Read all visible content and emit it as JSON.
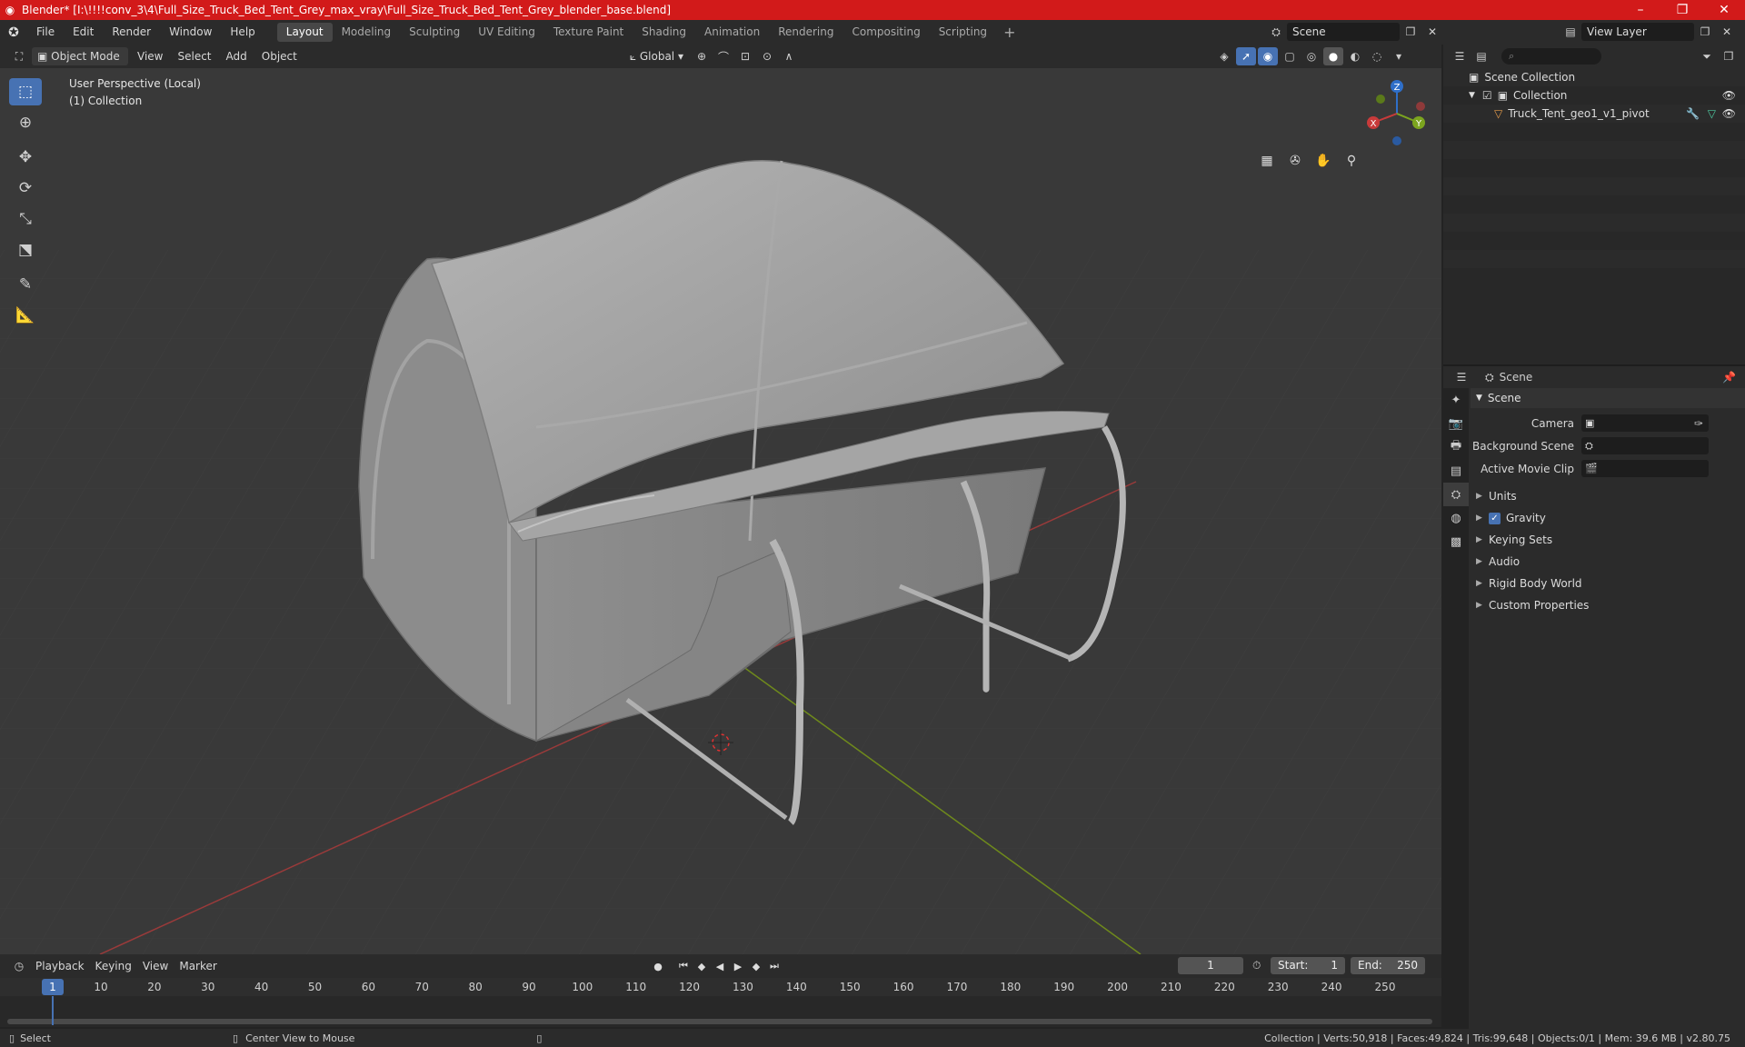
{
  "window": {
    "title": "Blender* [I:\\!!!!conv_3\\4\\Full_Size_Truck_Bed_Tent_Grey_max_vray\\Full_Size_Truck_Bed_Tent_Grey_blender_base.blend]",
    "minimize": "–",
    "maximize": "❐",
    "close": "✕"
  },
  "menu": {
    "file": "File",
    "edit": "Edit",
    "render": "Render",
    "window": "Window",
    "help": "Help"
  },
  "workspaces": [
    "Layout",
    "Modeling",
    "Sculpting",
    "UV Editing",
    "Texture Paint",
    "Shading",
    "Animation",
    "Rendering",
    "Compositing",
    "Scripting"
  ],
  "scene_selector": {
    "value": "Scene"
  },
  "view_layer": {
    "value": "View Layer"
  },
  "viewport_header": {
    "mode": "Object Mode",
    "view": "View",
    "select": "Select",
    "add": "Add",
    "object": "Object",
    "orientation": "Global"
  },
  "viewport": {
    "perspective": "User Perspective (Local)",
    "collection": "(1) Collection"
  },
  "outliner": {
    "root": "Scene Collection",
    "collection": "Collection",
    "object": "Truck_Tent_geo1_v1_pivot"
  },
  "properties": {
    "header": "Scene",
    "panel": "Scene",
    "camera_label": "Camera",
    "background_label": "Background Scene",
    "movieclip_label": "Active Movie Clip",
    "subpanels": [
      "Units",
      "Gravity",
      "Keying Sets",
      "Audio",
      "Rigid Body World",
      "Custom Properties"
    ]
  },
  "timeline": {
    "playback": "Playback",
    "keying": "Keying",
    "view": "View",
    "marker": "Marker",
    "current_frame": "1",
    "start_label": "Start:",
    "start_value": "1",
    "end_label": "End:",
    "end_value": "250",
    "ticks": [
      "1",
      "10",
      "20",
      "30",
      "40",
      "50",
      "60",
      "70",
      "80",
      "90",
      "100",
      "110",
      "120",
      "130",
      "140",
      "150",
      "160",
      "170",
      "180",
      "190",
      "200",
      "210",
      "220",
      "230",
      "240",
      "250"
    ]
  },
  "statusbar": {
    "select": "Select",
    "center": "Center View to Mouse",
    "stats": "Collection | Verts:50,918 | Faces:49,824 | Tris:99,648 | Objects:0/1 | Mem: 39.6 MB | v2.80.75"
  },
  "colors": {
    "titlebar": "#d21a1a",
    "accent": "#4772b3",
    "axis_x": "#b23a3a",
    "axis_y": "#7a9a1e"
  }
}
